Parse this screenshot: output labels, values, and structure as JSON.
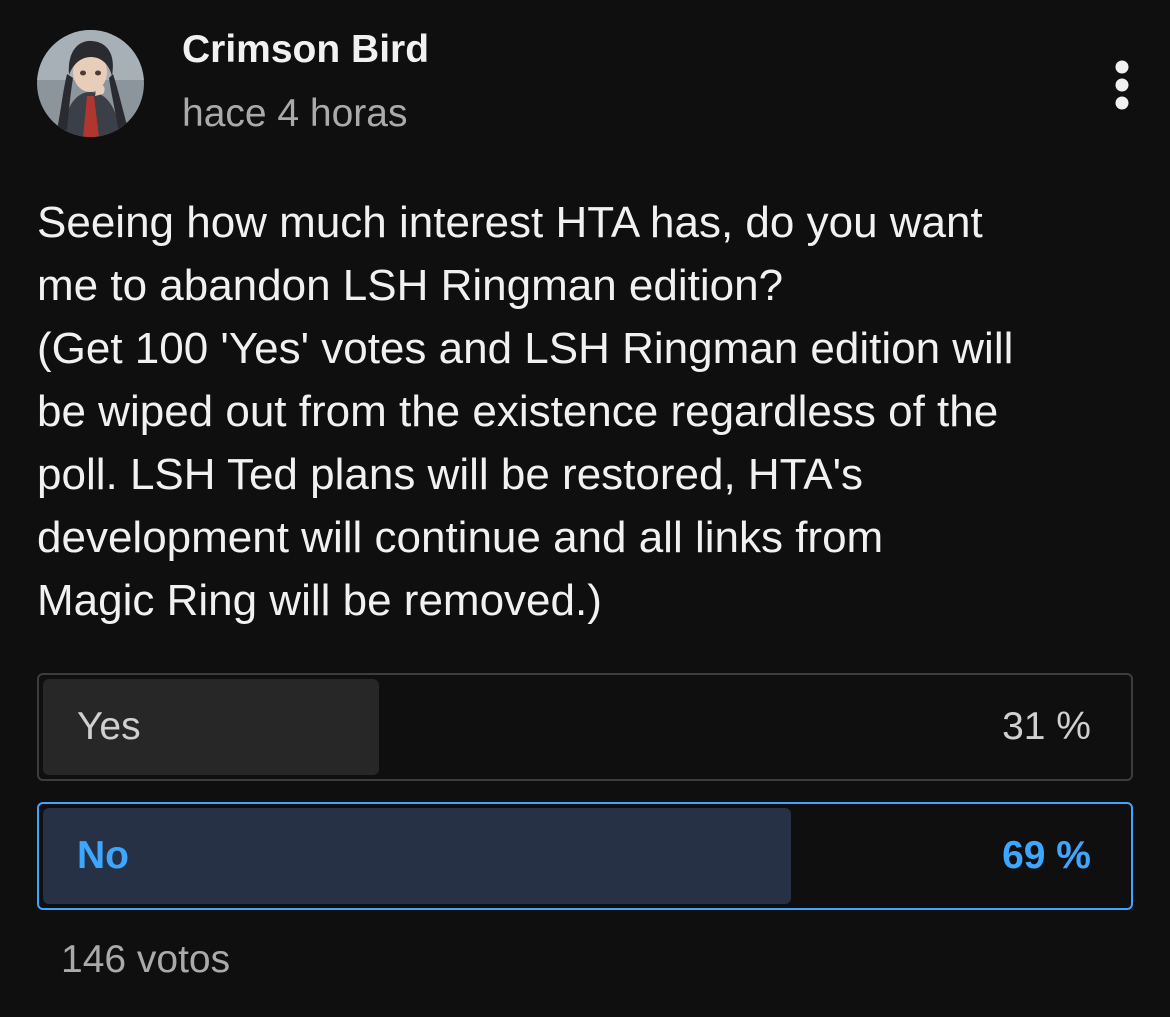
{
  "post": {
    "author": "Crimson Bird",
    "timestamp": "hace 4 horas",
    "avatar_icon": "anime-character-avatar",
    "menu_icon": "more-vertical-icon",
    "text": "Seeing how much interest HTA has, do you want\nme to abandon LSH Ringman edition?\n(Get 100 'Yes' votes and LSH Ringman edition will\nbe wiped out from the existence regardless of the\npoll. LSH Ted plans will be restored, HTA's\ndevelopment will continue and all links from\nMagic Ring will be removed.)"
  },
  "poll": {
    "options": [
      {
        "label": "Yes",
        "percent_text": "31 %",
        "percent": 31,
        "selected": false
      },
      {
        "label": "No",
        "percent_text": "69 %",
        "percent": 69,
        "selected": true
      }
    ],
    "total_votes": "146 votos"
  },
  "colors": {
    "background": "#0f0f0f",
    "accent": "#3ea6ff",
    "muted_text": "#aaaaaa",
    "selected_fill": "#263145",
    "unselected_fill": "#272727"
  }
}
